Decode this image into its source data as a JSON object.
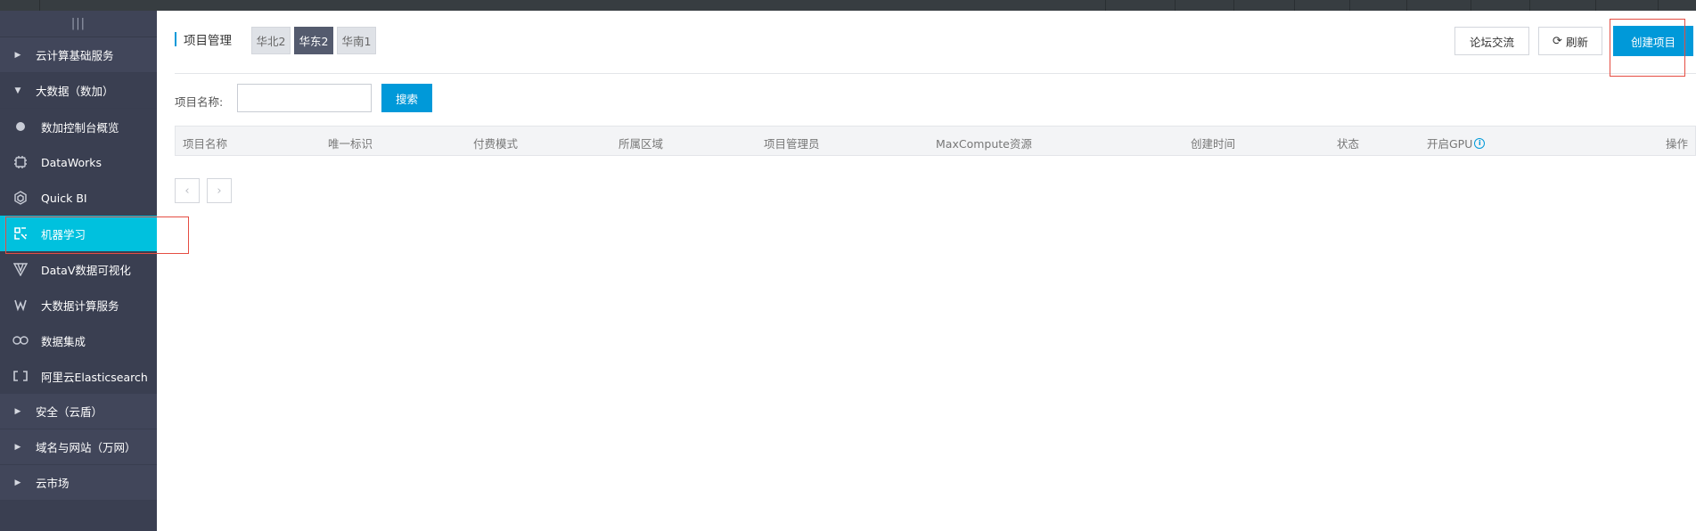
{
  "sidebar": {
    "toggle_icon": "menu-bars-icon",
    "items": [
      {
        "type": "group",
        "label": "云计算基础服务",
        "icon": "caret-right-icon"
      },
      {
        "type": "group",
        "label": "大数据（数加）",
        "icon": "caret-down-icon"
      },
      {
        "type": "sub",
        "label": "数加控制台概览",
        "icon": "circle-icon"
      },
      {
        "type": "sub",
        "label": "DataWorks",
        "icon": "dataworks-icon"
      },
      {
        "type": "sub",
        "label": "Quick BI",
        "icon": "quickbi-icon"
      },
      {
        "type": "sub",
        "label": "机器学习",
        "icon": "machine-learning-icon",
        "active": true
      },
      {
        "type": "sub",
        "label": "DataV数据可视化",
        "icon": "datav-icon"
      },
      {
        "type": "sub",
        "label": "大数据计算服务",
        "icon": "compute-icon"
      },
      {
        "type": "sub",
        "label": "数据集成",
        "icon": "integration-icon"
      },
      {
        "type": "sub",
        "label": "阿里云Elasticsearch",
        "icon": "elasticsearch-icon"
      },
      {
        "type": "group",
        "label": "安全（云盾）",
        "icon": "caret-right-icon"
      },
      {
        "type": "group",
        "label": "域名与网站（万网）",
        "icon": "caret-right-icon"
      },
      {
        "type": "group",
        "label": "云市场",
        "icon": "caret-right-icon"
      }
    ]
  },
  "header": {
    "title": "项目管理",
    "regions": [
      "华北2",
      "华东2",
      "华南1"
    ],
    "selected_region": "华东2",
    "forum_label": "论坛交流",
    "refresh_label": "刷新",
    "create_label": "创建项目"
  },
  "search": {
    "label": "项目名称:",
    "value": "",
    "placeholder": "",
    "button_label": "搜索"
  },
  "table": {
    "columns": [
      "项目名称",
      "唯一标识",
      "付费模式",
      "所属区域",
      "项目管理员",
      "MaxCompute资源",
      "创建时间",
      "状态",
      "开启GPU",
      "操作"
    ],
    "rows": []
  },
  "pagination": {
    "prev_label": "‹",
    "next_label": "›"
  },
  "colors": {
    "accent": "#0099d9",
    "sidebar_bg": "#3a3f51",
    "active_item": "#00c1de",
    "highlight_box": "#e54d42"
  }
}
